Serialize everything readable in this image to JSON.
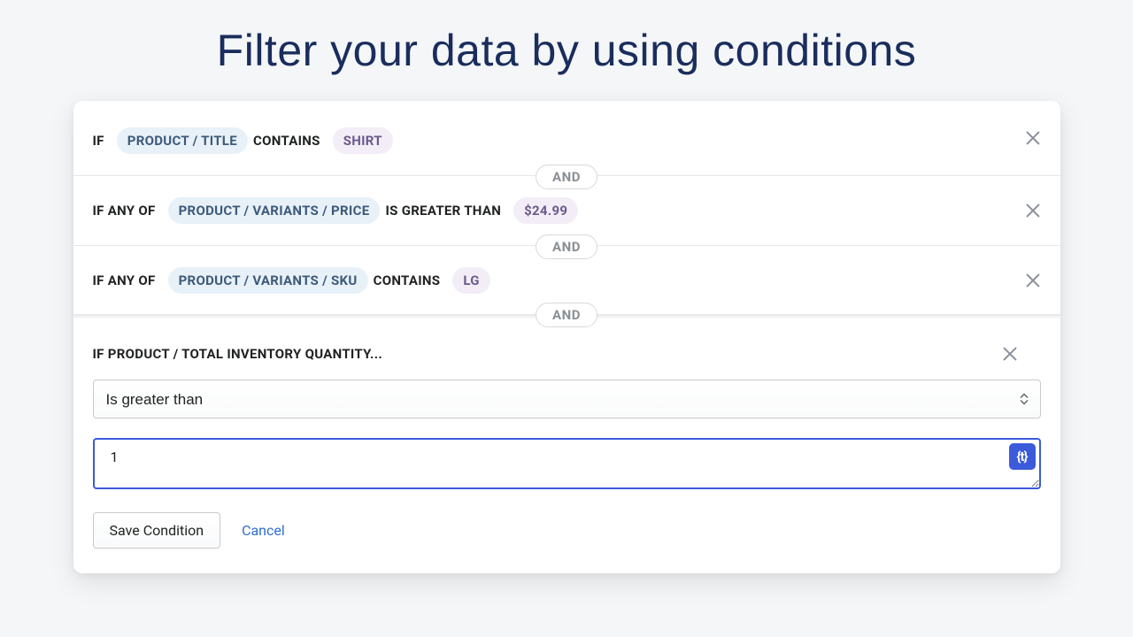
{
  "page": {
    "title": "Filter your data by using conditions"
  },
  "joiner": "AND",
  "conditions": [
    {
      "prefix": "IF",
      "field": "PRODUCT / TITLE",
      "operator": "CONTAINS",
      "value": "SHIRT"
    },
    {
      "prefix": "IF ANY OF",
      "field": "PRODUCT / VARIANTS / PRICE",
      "operator": "IS GREATER THAN",
      "value": "$24.99"
    },
    {
      "prefix": "IF ANY OF",
      "field": "PRODUCT / VARIANTS / SKU",
      "operator": "CONTAINS",
      "value": "LG"
    }
  ],
  "editor": {
    "label": "IF PRODUCT / TOTAL INVENTORY QUANTITY...",
    "operator_selected": "Is greater than",
    "value": "1",
    "token_button": "{t}"
  },
  "actions": {
    "save": "Save Condition",
    "cancel": "Cancel"
  }
}
